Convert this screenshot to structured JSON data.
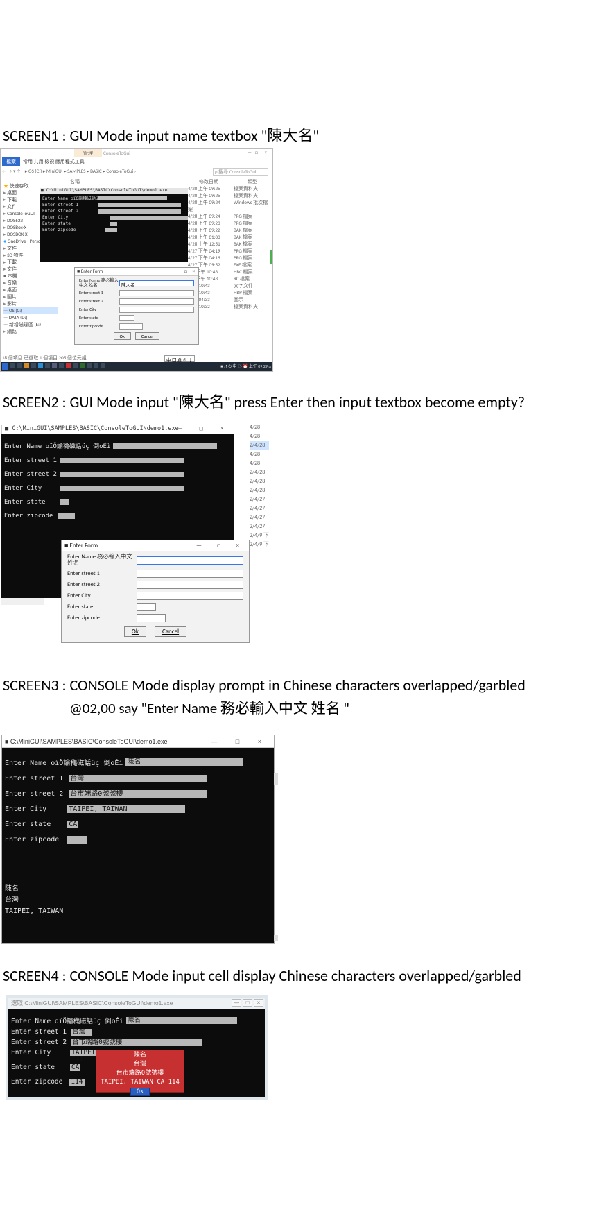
{
  "captions": {
    "s1": "SCREEN1 : GUI Mode input name textbox \"陳大名\"",
    "s2": "SCREEN2 : GUI Mode input \"陳大名\" press Enter then input textbox become empty?",
    "s3": "SCREEN3 : CONSOLE Mode display prompt in Chinese characters overlapped/garbled",
    "s3b": "@02,00 say \"Enter Name  務必輸入中文  姓名  \"",
    "s4": "SCREEN4 : CONSOLE Mode input cell display Chinese characters overlapped/garbled"
  },
  "s1": {
    "ribbon_tab": "管理",
    "ribbon_right": "ConsoleToGui",
    "win_min": "—",
    "win_btns": "□  ×",
    "menu_file": "檔案",
    "menu_items": "常用   共用   檢視   應用程式工具",
    "addr_nav": "← → ▾ ↑",
    "addr_path": "▸ OS (C:) ▸ MiniGUI ▸ SAMPLES ▸ BASIC ▸ ConsoleToGui ›",
    "search_placeholder": "搜尋 ConsoleToGui",
    "col_name": "名稱",
    "col_date": "修改日期",
    "col_type": "類型",
    "tree": {
      "quick": "快速存取",
      "desktop": "桌面",
      "download": "下載",
      "docs": "文件",
      "ctg": "ConsoleToGUI",
      "dos622": "DOS622",
      "dosboxx": "DOSBox-X",
      "dosboxx2": "DOSBOX-X",
      "onedrive": "OneDrive - Perso",
      "docs2": "文件",
      "3d": "3D 物件",
      "dl2": "下載",
      "docs3": "文件",
      "pc": "本機",
      "music": "音樂",
      "desktop2": "桌面",
      "pics": "圖片",
      "vids": "影片",
      "osc": "OS (C:)",
      "datad": "DATA (D:)",
      "ext": "新增磁碟區 (E:)",
      "net": "網路"
    },
    "files": [
      {
        "dt": "4/28 上午 09:25",
        "tp": "檔案資料夾"
      },
      {
        "dt": "4/28 上午 09:25",
        "tp": "檔案資料夾"
      },
      {
        "dt": "4/28 上午 09:24",
        "tp": "Windows 批次檔案"
      },
      {
        "dt": "4/28 上午 09:24",
        "tp": "PRG 檔案"
      },
      {
        "dt": "4/28 上午 09:23",
        "tp": "PRG 檔案"
      },
      {
        "dt": "4/28 上午 09:22",
        "tp": "BAK 檔案"
      },
      {
        "dt": "4/28 上午 01:03",
        "tp": "BAK 檔案"
      },
      {
        "dt": "4/28 上午 12:51",
        "tp": "BAK 檔案"
      },
      {
        "dt": "4/27 下午 04:19",
        "tp": "PRG 檔案"
      },
      {
        "dt": "4/27 下午 04:16",
        "tp": "PRG 檔案"
      },
      {
        "dt": "4/27 下午 09:52",
        "tp": "EXE 檔案"
      },
      {
        "dt": "4/9 下午 10:43",
        "tp": "HBC 檔案"
      },
      {
        "dt": "4/9 下午 10:43",
        "tp": "RC 檔案"
      },
      {
        "dt": "下午 10:43",
        "tp": "文字文件"
      },
      {
        "dt": "下午 10:43",
        "tp": "HBP 檔案"
      },
      {
        "dt": "下午 04:33",
        "tp": "圖示"
      },
      {
        "dt": "下午 10:32",
        "tp": "檔案資料夾"
      }
    ],
    "console": {
      "title": "■ C:\\MiniGUI\\SAMPLES\\BASIC\\ConsoleToGUI\\demo1.exe",
      "name_lbl": "Enter Name oïÖ諭穐磁話üç 倒oÉì",
      "st1_lbl": "Enter street 1",
      "st2_lbl": "Enter street 2",
      "city_lbl": "Enter City",
      "state_lbl": "Enter state",
      "zip_lbl": "Enter zipcode"
    },
    "form": {
      "title": "Enter Form",
      "win_controls": "—  □  ×",
      "name_lbl": "Enter Name 務必輸入中文 姓名",
      "name_val": "陳大名",
      "st1_lbl": "Enter street 1",
      "st2_lbl": "Enter street 2",
      "city_lbl": "Enter City",
      "state_lbl": "Enter state",
      "zip_lbl": "Enter zipcode",
      "ok": "Ok",
      "cancel": "Cancel"
    },
    "status": "18 個項目   已選取 1 個項目  208 個位元組",
    "ime": "中 囗 倉 ⚙ ⋮",
    "clock": "■ ⮃ ⏻ 中 ☁ ⏰   上午 09:29   □"
  },
  "s2": {
    "dates": [
      "4/28",
      "4/28",
      "2/4/28",
      "4/28",
      "4/28",
      "2/4/28",
      "2/4/28",
      "2/4/28",
      "2/4/27",
      "2/4/27",
      "2/4/27",
      "2/4/27",
      "2/4/9 下",
      "2/4/9 下"
    ],
    "console": {
      "title": "■ C:\\MiniGUI\\SAMPLES\\BASIC\\ConsoleToGUI\\demo1.exe",
      "win_controls": "—      □      ×",
      "name_lbl": "Enter Name oïÖ諭穐磁話üç 倒oÉì",
      "st1_lbl": "Enter street 1",
      "st2_lbl": "Enter street 2",
      "city_lbl": "Enter City",
      "state_lbl": "Enter state",
      "zip_lbl": "Enter zipcode"
    },
    "form": {
      "title": "Enter Form",
      "win_controls": "—      □      ×",
      "name_lbl": "Enter Name 務必輸入中文 姓名",
      "st1_lbl": "Enter street 1",
      "st2_lbl": "Enter street 2",
      "city_lbl": "Enter City",
      "state_lbl": "Enter state",
      "zip_lbl": "Enter zipcode",
      "ok": "Ok",
      "cancel": "Cancel"
    }
  },
  "s3": {
    "title": "■ C:\\MiniGUI\\SAMPLES\\BASIC\\ConsoleToGUI\\demo1.exe",
    "win_controls": "—      □      ×",
    "name_lbl": "Enter Name oïÖ諭穐磁話üç 倒oÉì",
    "name_val": "陳名",
    "st1_lbl": "Enter street 1",
    "st1_val": "台灣",
    "st2_lbl": "Enter street 2",
    "st2_val": "台市端路0號號樓",
    "city_lbl": "Enter City",
    "city_val": "TAIPEI, TAIWAN",
    "state_lbl": "Enter state",
    "state_val": "CA",
    "zip_lbl": "Enter zipcode",
    "out1": "陳名",
    "out2": "台灣",
    "out3": "TAIPEI, TAIWAN"
  },
  "s4": {
    "title": "選取 C:\\MiniGUI\\SAMPLES\\BASIC\\ConsoleToGUI\\demo1.exe",
    "wc_min": "—",
    "wc_max": "□",
    "wc_close": "×",
    "name_lbl": "Enter Name oïÖ諭穐磁話üç 倒oÉì",
    "name_val": "陳名",
    "st1_lbl": "Enter street 1",
    "st1_val": "台灣",
    "st2_lbl": "Enter street 2",
    "st2_val": "台市端路0號號樓",
    "city_lbl": "Enter City",
    "city_val": "TAIPEI, TAI",
    "state_lbl": "Enter state",
    "state_val": "CA",
    "zip_lbl": "Enter zipcode",
    "zip_val": "114",
    "popup": {
      "l1": "陳名",
      "l2": "台灣",
      "l3": "台市端路0號號樓",
      "l4": "TAIPEI, TAIWAN CA  114",
      "ok": "Ok"
    }
  }
}
